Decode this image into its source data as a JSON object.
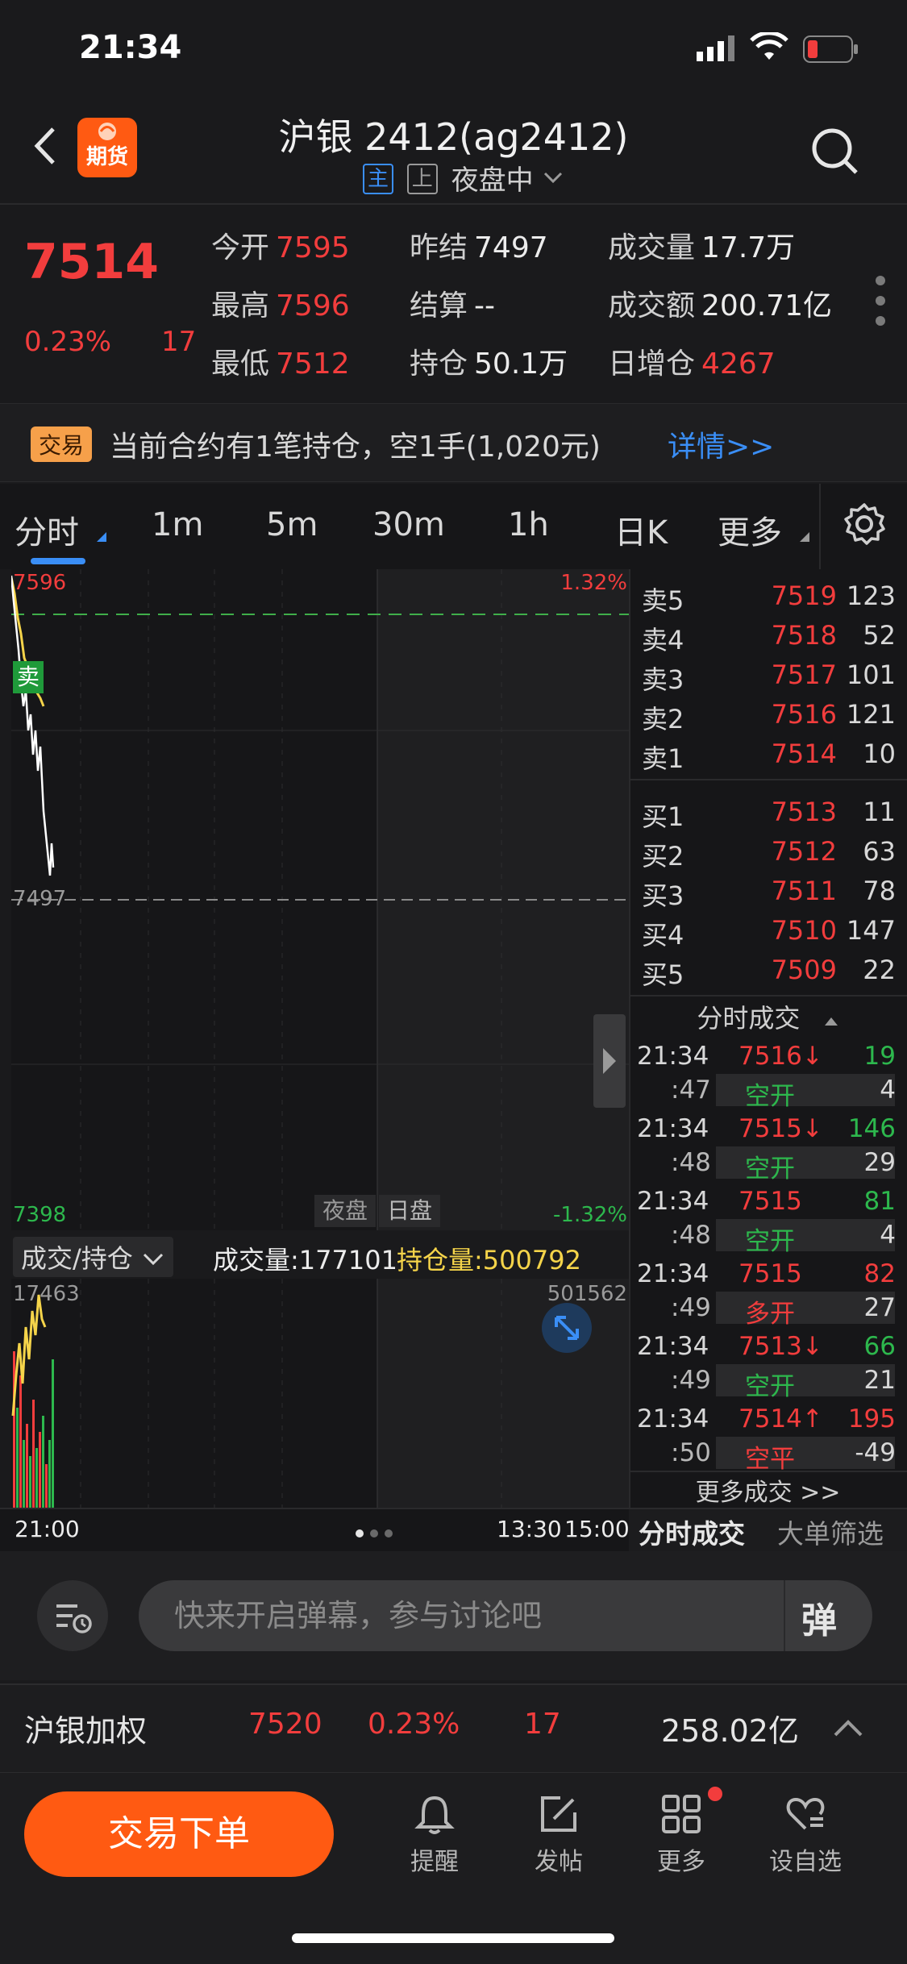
{
  "status": {
    "time": "21:34"
  },
  "header": {
    "app_badge": "期货",
    "title": "沪银 2412(ag2412)",
    "tag_main": "主",
    "tag_shang": "上",
    "session": "夜盘中"
  },
  "quote": {
    "last": "7514",
    "change_pct": "0.23%",
    "change": "17",
    "fields": [
      {
        "label": "今开",
        "value": "7595"
      },
      {
        "label": "昨结",
        "value": "7497"
      },
      {
        "label": "成交量",
        "value": "17.7万"
      },
      {
        "label": "最高",
        "value": "7596"
      },
      {
        "label": "结算",
        "value": "--"
      },
      {
        "label": "成交额",
        "value": "200.71亿"
      },
      {
        "label": "最低",
        "value": "7512"
      },
      {
        "label": "持仓",
        "value": "50.1万"
      },
      {
        "label": "日增仓",
        "value": "4267"
      }
    ]
  },
  "notice": {
    "badge": "交易",
    "text": "当前合约有1笔持仓，空1手(1,020元)",
    "link": "详情>>"
  },
  "tabs": [
    "分时",
    "1m",
    "5m",
    "30m",
    "1h",
    "日K",
    "更多"
  ],
  "chart": {
    "price_high": "7596",
    "pct_high": "1.32%",
    "price_ref": "7497",
    "price_low": "7398",
    "pct_low": "-1.32%",
    "sell_marker": "卖",
    "session_night": "夜盘",
    "session_day": "日盘",
    "vol_selector": "成交/持仓",
    "vol_label": "成交量:177101",
    "oi_label": "持仓量:500792",
    "vol_max": "17463",
    "oi_max": "501562",
    "time_start": "21:00",
    "time_mid": "13:30",
    "time_end": "15:00"
  },
  "orderbook": {
    "asks": [
      {
        "label": "卖5",
        "price": "7519",
        "vol": "123"
      },
      {
        "label": "卖4",
        "price": "7518",
        "vol": "52"
      },
      {
        "label": "卖3",
        "price": "7517",
        "vol": "101"
      },
      {
        "label": "卖2",
        "price": "7516",
        "vol": "121"
      },
      {
        "label": "卖1",
        "price": "7514",
        "vol": "10"
      }
    ],
    "bids": [
      {
        "label": "买1",
        "price": "7513",
        "vol": "11"
      },
      {
        "label": "买2",
        "price": "7512",
        "vol": "63"
      },
      {
        "label": "买3",
        "price": "7511",
        "vol": "78"
      },
      {
        "label": "买4",
        "price": "7510",
        "vol": "147"
      },
      {
        "label": "买5",
        "price": "7509",
        "vol": "22"
      }
    ]
  },
  "trades": {
    "title": "分时成交",
    "rows": [
      {
        "time": "21:34",
        "price": "7516↓",
        "vol": "19",
        "sec": ":47",
        "kind": "空开",
        "oi": "4"
      },
      {
        "time": "21:34",
        "price": "7515↓",
        "vol": "146",
        "sec": ":48",
        "kind": "空开",
        "oi": "29"
      },
      {
        "time": "21:34",
        "price": "7515",
        "vol": "81",
        "sec": ":48",
        "kind": "空开",
        "oi": "4"
      },
      {
        "time": "21:34",
        "price": "7515",
        "vol": "82",
        "sec": ":49",
        "kind": "多开",
        "oi": "27"
      },
      {
        "time": "21:34",
        "price": "7513↓",
        "vol": "66",
        "sec": ":49",
        "kind": "空开",
        "oi": "21"
      },
      {
        "time": "21:34",
        "price": "7514↑",
        "vol": "195",
        "sec": ":50",
        "kind": "空平",
        "oi": "-49"
      }
    ],
    "more": "更多成交 >>",
    "tab_ticks": "分时成交",
    "tab_big": "大单筛选"
  },
  "comment": {
    "placeholder": "快来开启弹幕，参与讨论吧",
    "danmu": "弹"
  },
  "weighted": {
    "name": "沪银加权",
    "price": "7520",
    "pct": "0.23%",
    "change": "17",
    "amount": "258.02亿"
  },
  "footer": {
    "trade_button": "交易下单",
    "items": [
      "提醒",
      "发帖",
      "更多",
      "设自选"
    ]
  },
  "colors": {
    "up": "#f23d3d",
    "down": "#2db84d",
    "accent": "#ff5a12",
    "link": "#3a8ef6",
    "oi_line": "#f5d44a"
  }
}
